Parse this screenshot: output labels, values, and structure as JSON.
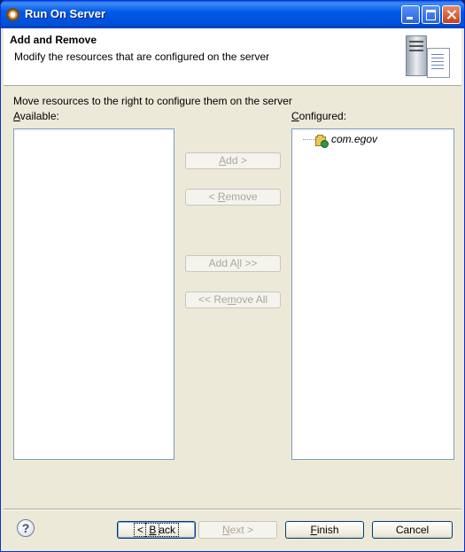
{
  "window": {
    "title": "Run On Server"
  },
  "header": {
    "title": "Add and Remove",
    "description": "Modify the resources that are configured on the server"
  },
  "main": {
    "instruction": "Move resources to the right to configure them on the server",
    "available_label": "Available:",
    "configured_label": "Configured:",
    "available_items": [],
    "configured_items": [
      {
        "label": "com.egov"
      }
    ]
  },
  "buttons": {
    "add": "Add >",
    "remove": "< Remove",
    "add_all": "Add All >>",
    "remove_all": "<< Remove All"
  },
  "footer": {
    "help": "?",
    "back": "< Back",
    "next": "Next >",
    "finish": "Finish",
    "cancel": "Cancel"
  },
  "colors": {
    "titlebar": "#0058e6",
    "dialog_bg": "#ece9d8",
    "list_border": "#7f9db9"
  }
}
